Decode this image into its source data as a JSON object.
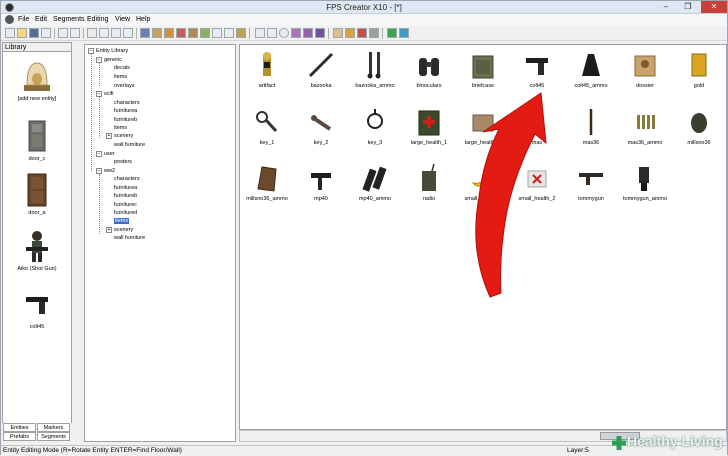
{
  "window": {
    "title": "FPS Creator X10 - [*]",
    "minimize": "–",
    "maximize": "❐",
    "close": "✕"
  },
  "menu": {
    "items": [
      "File",
      "Edit",
      "Segments",
      "Editing",
      "View",
      "Help"
    ]
  },
  "library": {
    "header": "Library",
    "items": [
      {
        "label": "[add new entity]",
        "icon": "bell-jar-icon"
      },
      {
        "label": "door_c",
        "icon": "door-icon"
      },
      {
        "label": "door_a",
        "icon": "door-icon"
      },
      {
        "label": "Aiko (Shot Gun)",
        "icon": "character-icon"
      },
      {
        "label": "colt45",
        "icon": "pistol-icon"
      }
    ],
    "tabs": [
      "Entities",
      "Markers",
      "Prefabs",
      "Segments"
    ]
  },
  "tree": {
    "root": "Entity Library",
    "nodes": [
      {
        "label": "generic",
        "level": 1,
        "expander": "-"
      },
      {
        "label": "decals",
        "level": 2
      },
      {
        "label": "items",
        "level": 2
      },
      {
        "label": "overlays",
        "level": 2
      },
      {
        "label": "scifi",
        "level": 1,
        "expander": "-"
      },
      {
        "label": "characters",
        "level": 2
      },
      {
        "label": "furniturea",
        "level": 2
      },
      {
        "label": "furnitureb",
        "level": 2
      },
      {
        "label": "items",
        "level": 2
      },
      {
        "label": "scenery",
        "level": 2,
        "expander": "+"
      },
      {
        "label": "wall furniture",
        "level": 2
      },
      {
        "label": "user",
        "level": 1,
        "expander": "-"
      },
      {
        "label": "posters",
        "level": 2
      },
      {
        "label": "ww2",
        "level": 1,
        "expander": "-"
      },
      {
        "label": "characters",
        "level": 2
      },
      {
        "label": "furniturea",
        "level": 2
      },
      {
        "label": "furnitureb",
        "level": 2
      },
      {
        "label": "furniturec",
        "level": 2
      },
      {
        "label": "furnitured",
        "level": 2
      },
      {
        "label": "items",
        "level": 2,
        "selected": true
      },
      {
        "label": "scenery",
        "level": 2,
        "expander": "+"
      },
      {
        "label": "wall furniture",
        "level": 2
      }
    ]
  },
  "entities": [
    {
      "label": "artifact",
      "icon": "idol-icon"
    },
    {
      "label": "bazooka",
      "icon": "bazooka-icon"
    },
    {
      "label": "bazooka_ammo",
      "icon": "rocket-ammo-icon"
    },
    {
      "label": "binoculars",
      "icon": "binoculars-icon"
    },
    {
      "label": "briefcase",
      "icon": "briefcase-icon"
    },
    {
      "label": "colt45",
      "icon": "pistol-icon"
    },
    {
      "label": "colt45_ammo",
      "icon": "ammo-clip-icon"
    },
    {
      "label": "dossier",
      "icon": "dossier-icon"
    },
    {
      "label": "gold",
      "icon": "gold-bar-icon"
    },
    {
      "label": "key_1",
      "icon": "key-icon"
    },
    {
      "label": "key_2",
      "icon": "key-icon"
    },
    {
      "label": "key_3",
      "icon": "key-ring-icon"
    },
    {
      "label": "large_health_1",
      "icon": "medkit-icon"
    },
    {
      "label": "large_health_2",
      "icon": "supply-box-icon"
    },
    {
      "label": "mas",
      "icon": "rifle-icon"
    },
    {
      "label": "mas36",
      "icon": "rifle-icon"
    },
    {
      "label": "mas36_ammo",
      "icon": "bullets-icon"
    },
    {
      "label": "millsno36",
      "icon": "grenade-icon"
    },
    {
      "label": "millsno36_ammo",
      "icon": "grenade-crate-icon"
    },
    {
      "label": "mp40",
      "icon": "smg-icon"
    },
    {
      "label": "mp40_ammo",
      "icon": "magazine-icon"
    },
    {
      "label": "radio",
      "icon": "radio-icon"
    },
    {
      "label": "small_health_1",
      "icon": "banana-icon"
    },
    {
      "label": "small_health_2",
      "icon": "first-aid-box-icon"
    },
    {
      "label": "tommygun",
      "icon": "tommygun-icon"
    },
    {
      "label": "tommygun_ammo",
      "icon": "drum-magazine-icon"
    }
  ],
  "status": {
    "mode": "Entity Editing Mode (R=Rotate Entity  ENTER=Find Floor/Wall)",
    "layer": "Layer:5"
  },
  "watermark": {
    "text": "Healthy Living",
    "plus_color": "#2f9e5a"
  },
  "colors": {
    "selection": "#3a6fc9",
    "arrow": "#e41b13",
    "close_button": "#c7413a"
  }
}
